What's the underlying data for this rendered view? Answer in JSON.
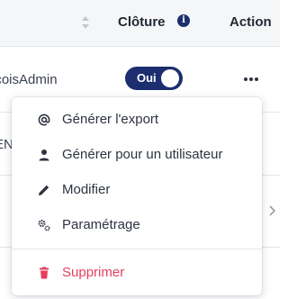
{
  "header": {
    "cloture_label": "Clôture",
    "info_glyph": "i",
    "action_label": "Action"
  },
  "rows": [
    {
      "user": "nçoisAdmin",
      "toggle_label": "Oui",
      "toggle_on": true
    },
    {
      "user": "EN"
    }
  ],
  "menu": {
    "items": [
      {
        "label": "Générer l'export",
        "icon": "at-icon"
      },
      {
        "label": "Générer pour un utilisateur",
        "icon": "user-icon"
      },
      {
        "label": "Modifier",
        "icon": "pencil-icon"
      },
      {
        "label": "Paramétrage",
        "icon": "gears-icon"
      },
      {
        "label": "Supprimer",
        "icon": "trash-icon"
      }
    ]
  },
  "colors": {
    "primary": "#1c2e6e",
    "danger": "#e5405e",
    "text": "#2d3340"
  }
}
